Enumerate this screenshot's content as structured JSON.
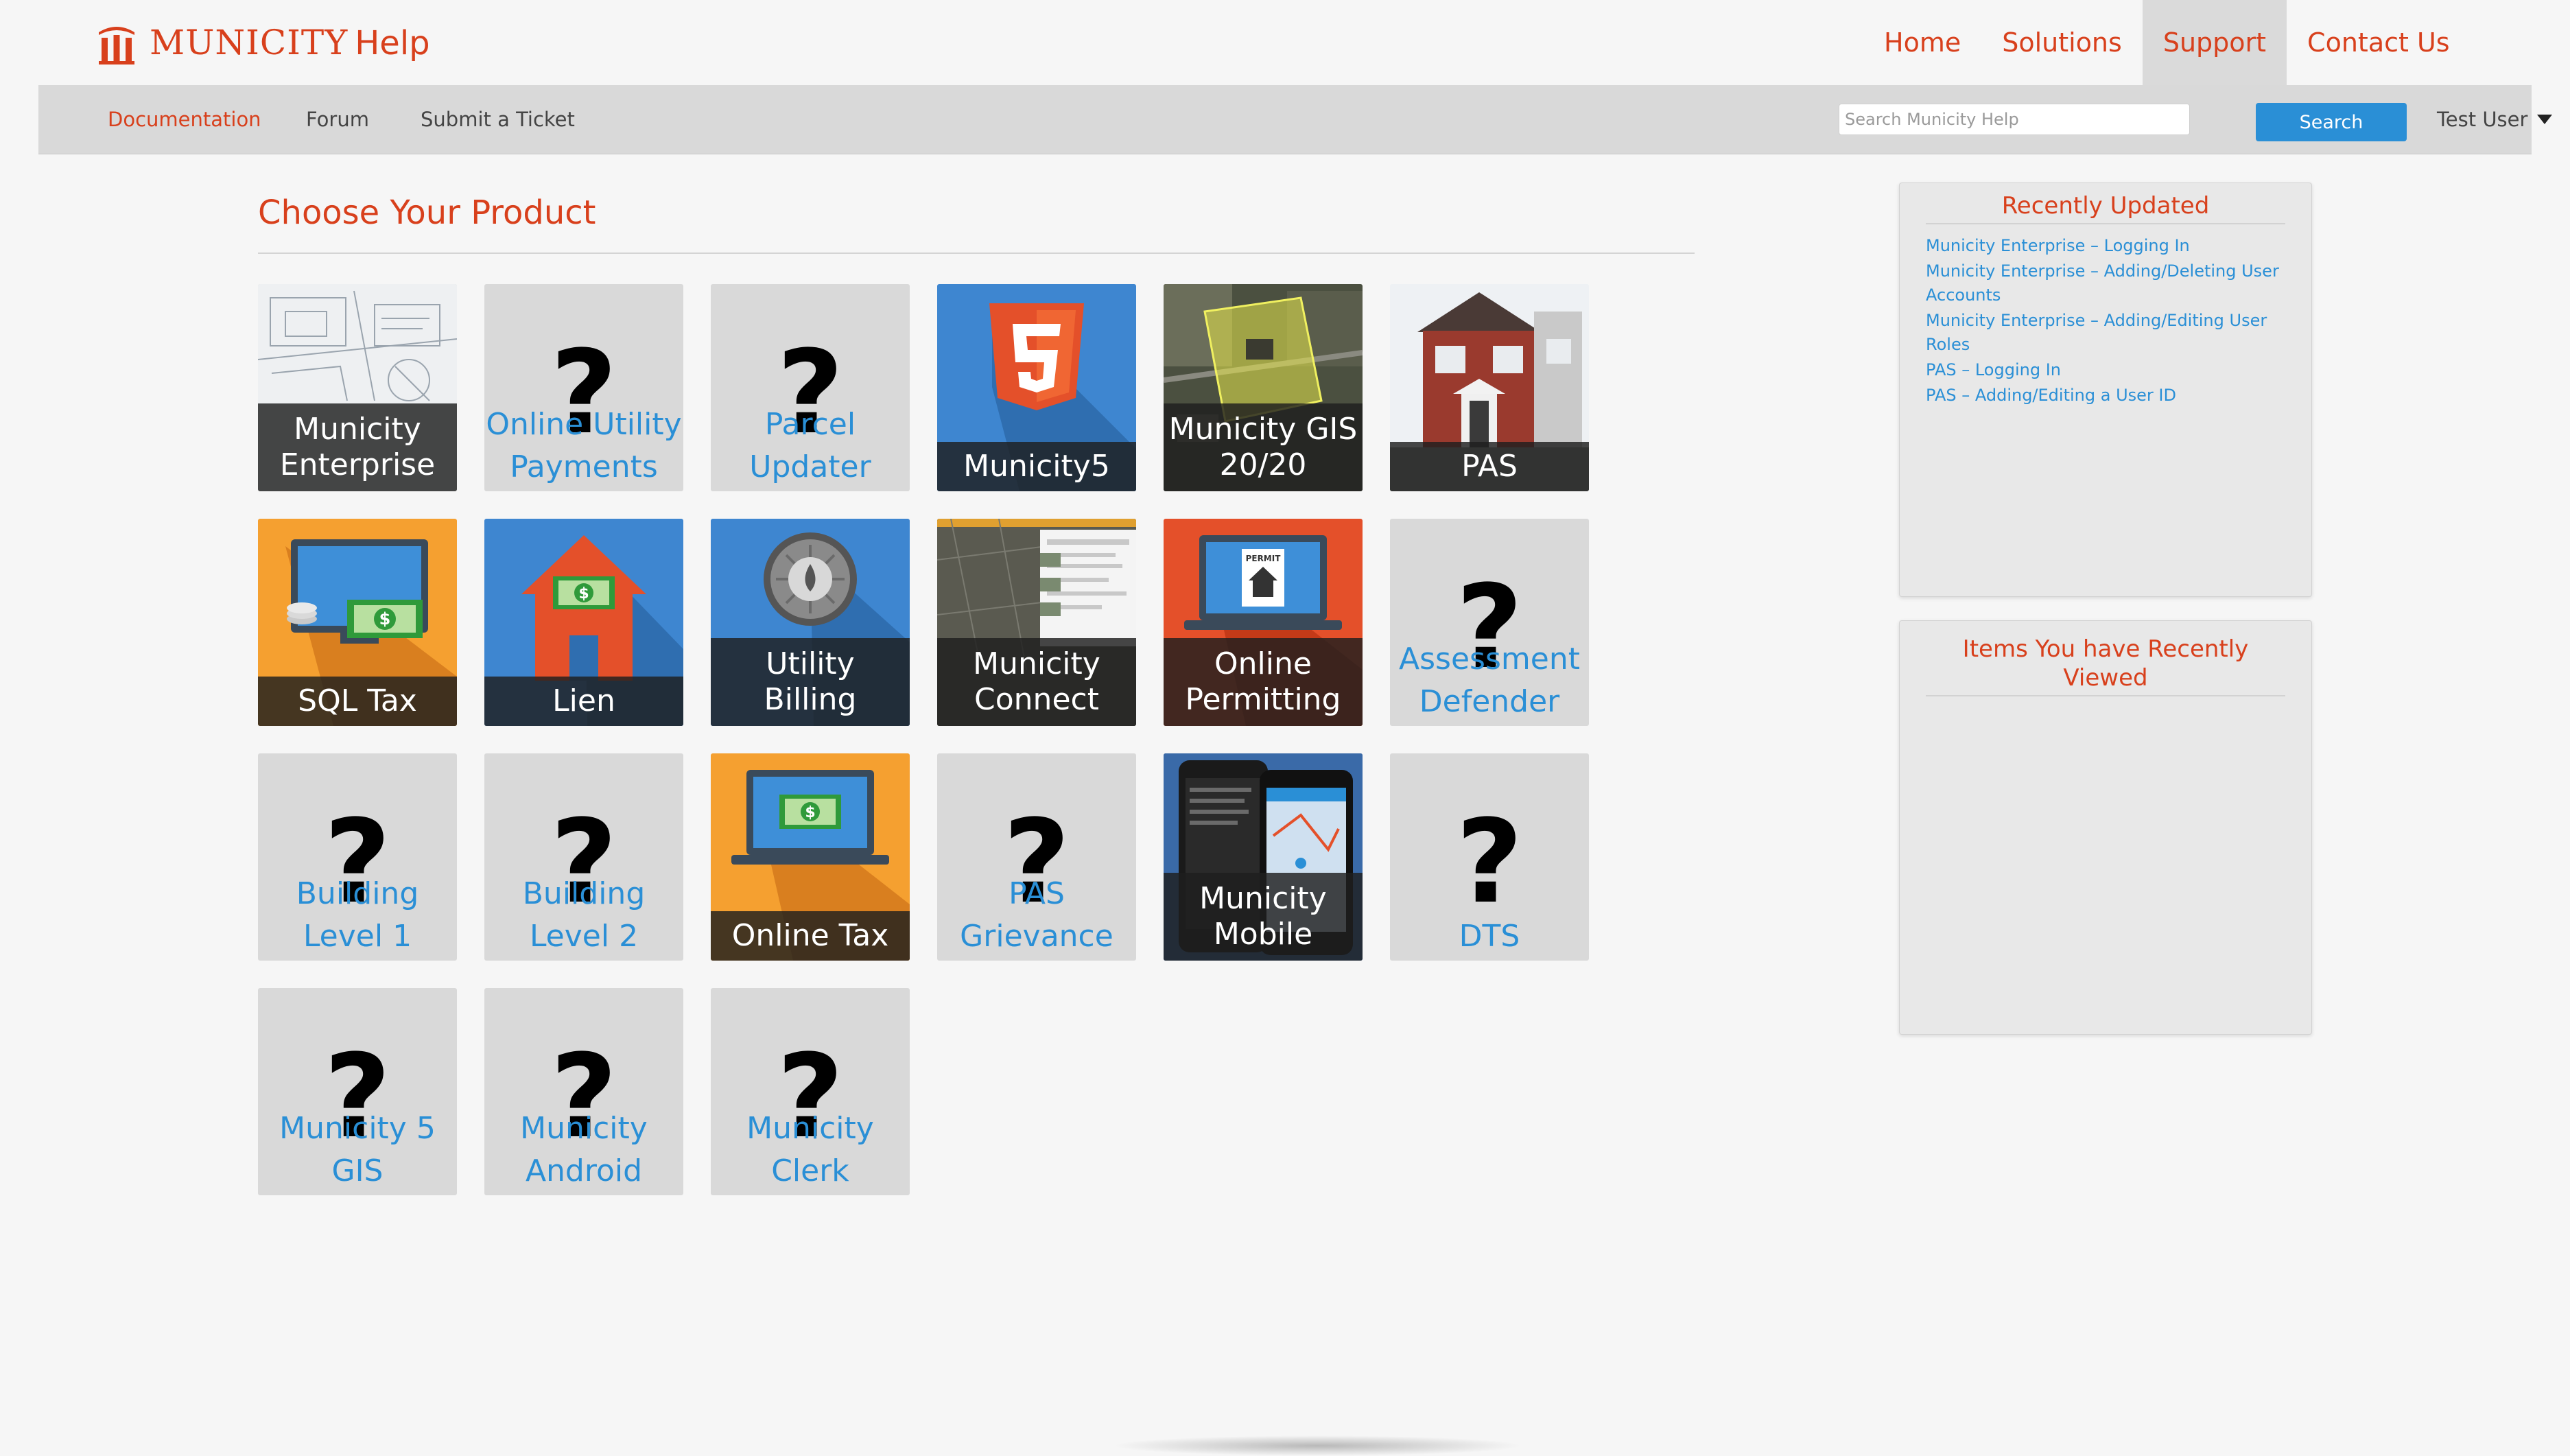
{
  "brand": {
    "name": "MUNICITY",
    "suffix": "Help"
  },
  "main_nav": [
    {
      "label": "Home",
      "active": false
    },
    {
      "label": "Solutions",
      "active": false
    },
    {
      "label": "Support",
      "active": true
    },
    {
      "label": "Contact Us",
      "active": false
    }
  ],
  "sub_nav": {
    "links": [
      {
        "label": "Documentation",
        "active": true
      },
      {
        "label": "Forum",
        "active": false
      },
      {
        "label": "Submit a Ticket",
        "active": false
      }
    ],
    "search_placeholder": "Search Municity Help",
    "search_button": "Search",
    "user_name": "Test User"
  },
  "page_title": "Choose Your Product",
  "products": [
    {
      "label": "Municity Enterprise",
      "style": "image",
      "icon": "blueprint-image"
    },
    {
      "label": "Online Utility Payments",
      "style": "placeholder",
      "icon": "question-mark-icon"
    },
    {
      "label": "Parcel Updater",
      "style": "placeholder",
      "icon": "question-mark-icon"
    },
    {
      "label": "Municity5",
      "style": "image",
      "icon": "html5-shield-icon"
    },
    {
      "label": "Municity GIS 20/20",
      "style": "image",
      "icon": "aerial-map-image"
    },
    {
      "label": "PAS",
      "style": "image",
      "icon": "house-photo-image"
    },
    {
      "label": "SQL Tax",
      "style": "image",
      "icon": "monitor-cash-icon"
    },
    {
      "label": "Lien",
      "style": "image",
      "icon": "house-cash-icon"
    },
    {
      "label": "Utility Billing",
      "style": "image",
      "icon": "water-meter-icon"
    },
    {
      "label": "Municity Connect",
      "style": "image",
      "icon": "map-screenshot-image"
    },
    {
      "label": "Online Permitting",
      "style": "image",
      "icon": "laptop-permit-icon"
    },
    {
      "label": "Assessment Defender",
      "style": "placeholder",
      "icon": "question-mark-icon"
    },
    {
      "label": "Building Level 1",
      "style": "placeholder",
      "icon": "question-mark-icon"
    },
    {
      "label": "Building Level 2",
      "style": "placeholder",
      "icon": "question-mark-icon"
    },
    {
      "label": "Online Tax",
      "style": "image",
      "icon": "laptop-cash-icon"
    },
    {
      "label": "PAS Grievance",
      "style": "placeholder",
      "icon": "question-mark-icon"
    },
    {
      "label": "Municity Mobile",
      "style": "image",
      "icon": "smartphones-image"
    },
    {
      "label": "DTS",
      "style": "placeholder",
      "icon": "question-mark-icon"
    },
    {
      "label": "Municity 5 GIS",
      "style": "placeholder",
      "icon": "question-mark-icon"
    },
    {
      "label": "Municity Android",
      "style": "placeholder",
      "icon": "question-mark-icon"
    },
    {
      "label": "Municity Clerk",
      "style": "placeholder",
      "icon": "question-mark-icon"
    }
  ],
  "placeholder_glyph": "?",
  "recently_updated": {
    "title": "Recently Updated",
    "items": [
      "Municity Enterprise – Logging In",
      "Municity Enterprise – Adding/Deleting User Accounts",
      "Municity Enterprise – Adding/Editing User Roles",
      "PAS – Logging In",
      "PAS – Adding/Editing a User ID"
    ]
  },
  "recently_viewed": {
    "title": "Items You have Recently Viewed",
    "items": []
  },
  "colors": {
    "brand_red": "#d8401c",
    "link_blue": "#2a8fd6",
    "tile_grey": "#d9d9d9"
  }
}
